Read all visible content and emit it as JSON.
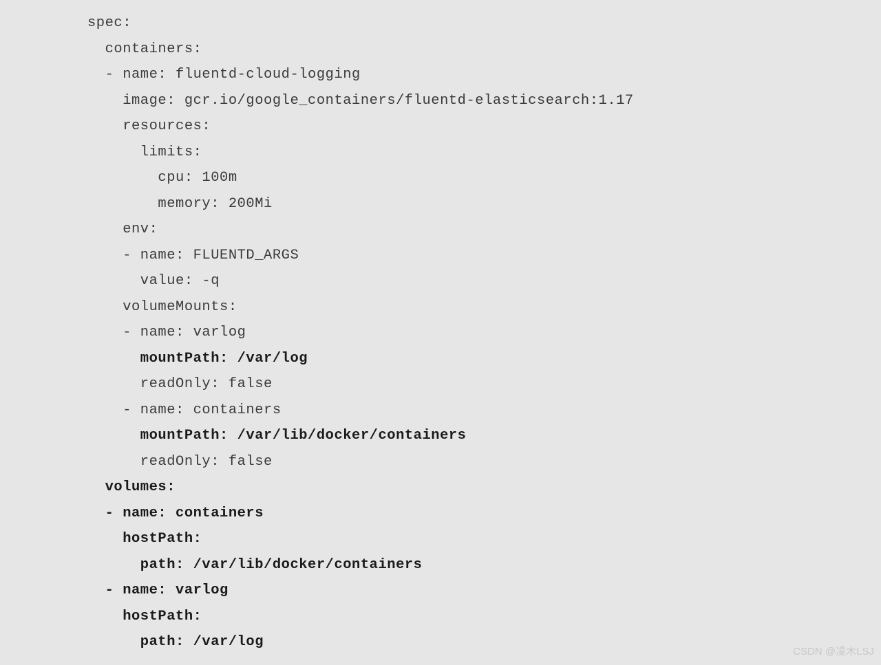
{
  "code": {
    "l01": "spec:",
    "l02": "  containers:",
    "l03": "  - name: fluentd-cloud-logging",
    "l04": "    image: gcr.io/google_containers/fluentd-elasticsearch:1.17",
    "l05": "    resources:",
    "l06": "      limits:",
    "l07": "        cpu: 100m",
    "l08": "        memory: 200Mi",
    "l09": "    env:",
    "l10": "    - name: FLUENTD_ARGS",
    "l11": "      value: -q",
    "l12": "    volumeMounts:",
    "l13": "    - name: varlog",
    "l14": "      mountPath: /var/log",
    "l15": "      readOnly: false",
    "l16": "    - name: containers",
    "l17": "      mountPath: /var/lib/docker/containers",
    "l18": "      readOnly: false",
    "l19": "  volumes:",
    "l20": "  - name: containers",
    "l21": "    hostPath:",
    "l22": "      path: /var/lib/docker/containers",
    "l23": "  - name: varlog",
    "l24": "    hostPath:",
    "l25": "      path: /var/log"
  },
  "watermark": "CSDN @凌木LSJ"
}
